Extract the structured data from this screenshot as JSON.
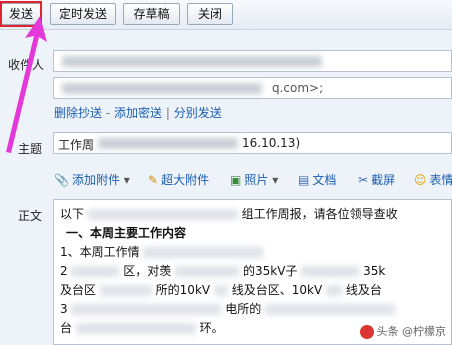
{
  "toolbar": {
    "send_label": "发送",
    "timed_send_label": "定时发送",
    "save_draft_label": "存草稿",
    "close_label": "关闭"
  },
  "recipients": {
    "to_label": "收件人",
    "cc_visible_fragment": "q.com>;"
  },
  "cc_actions": {
    "remove_cc": "删除抄送",
    "add_bcc": "添加密送",
    "separator": "|",
    "separate_send": "分别发送"
  },
  "subject": {
    "label": "主题",
    "value_prefix": "工作周",
    "value_suffix": "16.10.13)"
  },
  "attachments": {
    "add_attachment": "添加附件",
    "large_attachment": "超大附件",
    "photo": "照片",
    "document": "文档",
    "screenshot": "截屏",
    "emoji": "表情"
  },
  "body": {
    "label": "正文",
    "line1_start": "以下",
    "line1_end": "组工作周报，请各位领导查收",
    "line2": "一、本周主要工作内容",
    "line3": "1、本周工作情",
    "line4_a": "2",
    "line4_b": "区，对羡",
    "line4_c": "的35kV子",
    "line4_d": "35k",
    "line5_a": "及台区",
    "line5_b": "所的10kV",
    "line5_c": "线及台区、10kV",
    "line5_d": "线及台",
    "line6_a": "3",
    "line6_b": "电所的",
    "line7_a": "台",
    "line7_b": "环。"
  },
  "watermark": "头条 @柠檬京",
  "colors": {
    "highlight": "#e0242f",
    "arrow": "#e339d8",
    "link": "#1a5db0"
  }
}
